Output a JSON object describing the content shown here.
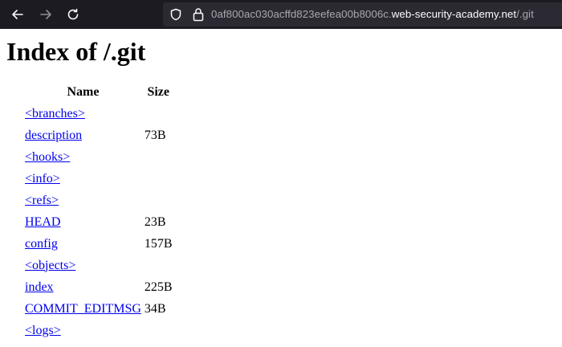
{
  "browser": {
    "url_subdomain": "0af800ac030acffd823eefea00b8006c.",
    "url_domain": "web-security-academy.net",
    "url_path": "/.git"
  },
  "page": {
    "title": "Index of /.git",
    "columns": {
      "name": "Name",
      "size": "Size"
    },
    "rows": [
      {
        "name": "<branches>",
        "size": ""
      },
      {
        "name": "description",
        "size": "73B"
      },
      {
        "name": "<hooks>",
        "size": ""
      },
      {
        "name": "<info>",
        "size": ""
      },
      {
        "name": "<refs>",
        "size": ""
      },
      {
        "name": "HEAD",
        "size": "23B"
      },
      {
        "name": "config",
        "size": "157B"
      },
      {
        "name": "<objects>",
        "size": ""
      },
      {
        "name": "index",
        "size": "225B"
      },
      {
        "name": "COMMIT_EDITMSG",
        "size": "34B"
      },
      {
        "name": "<logs>",
        "size": ""
      }
    ]
  }
}
